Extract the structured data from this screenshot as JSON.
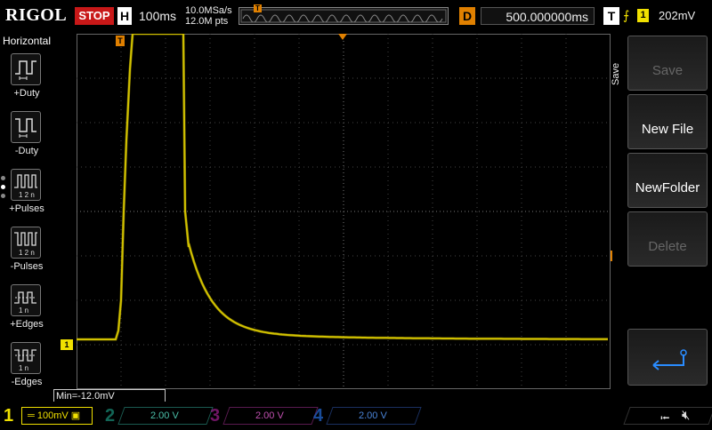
{
  "brand": "RIGOL",
  "run_state": "STOP",
  "horizontal": {
    "label": "H",
    "timebase": "100ms",
    "sample_rate": "10.0MSa/s",
    "mem_depth": "12.0M pts"
  },
  "delay": {
    "label": "D",
    "value": "500.000000ms"
  },
  "trigger": {
    "label": "T",
    "channel": "1",
    "level": "202mV",
    "marker": "T"
  },
  "left_panel": {
    "title": "Horizontal",
    "items": [
      {
        "label": "+Duty",
        "icon": "positive-duty-icon"
      },
      {
        "label": "-Duty",
        "icon": "negative-duty-icon"
      },
      {
        "label": "+Pulses",
        "icon": "positive-pulses-icon"
      },
      {
        "label": "-Pulses",
        "icon": "negative-pulses-icon"
      },
      {
        "label": "+Edges",
        "icon": "rising-edges-icon"
      },
      {
        "label": "-Edges",
        "icon": "falling-edges-icon"
      }
    ]
  },
  "right_panel": {
    "title": "Save",
    "buttons": [
      {
        "label": "Save",
        "enabled": false
      },
      {
        "label": "New File",
        "enabled": true
      },
      {
        "label": "NewFolder",
        "enabled": true
      },
      {
        "label": "Delete",
        "enabled": false
      },
      {
        "label": "",
        "icon": "enter-icon",
        "enabled": true
      }
    ]
  },
  "measurement": {
    "text": "Min=-12.0mV"
  },
  "channels": [
    {
      "num": "1",
      "scale": "100mV",
      "color": "#f0e000",
      "active": true
    },
    {
      "num": "2",
      "scale": "2.00 V",
      "color": "#1fa88f",
      "active": false
    },
    {
      "num": "3",
      "scale": "2.00 V",
      "color": "#a02090",
      "active": false
    },
    {
      "num": "4",
      "scale": "2.00 V",
      "color": "#2060c0",
      "active": false
    }
  ],
  "ch1_marker": "1",
  "colors": {
    "trace": "#f0e000",
    "trigger_marker": "#e08000",
    "stop": "#c81818"
  }
}
